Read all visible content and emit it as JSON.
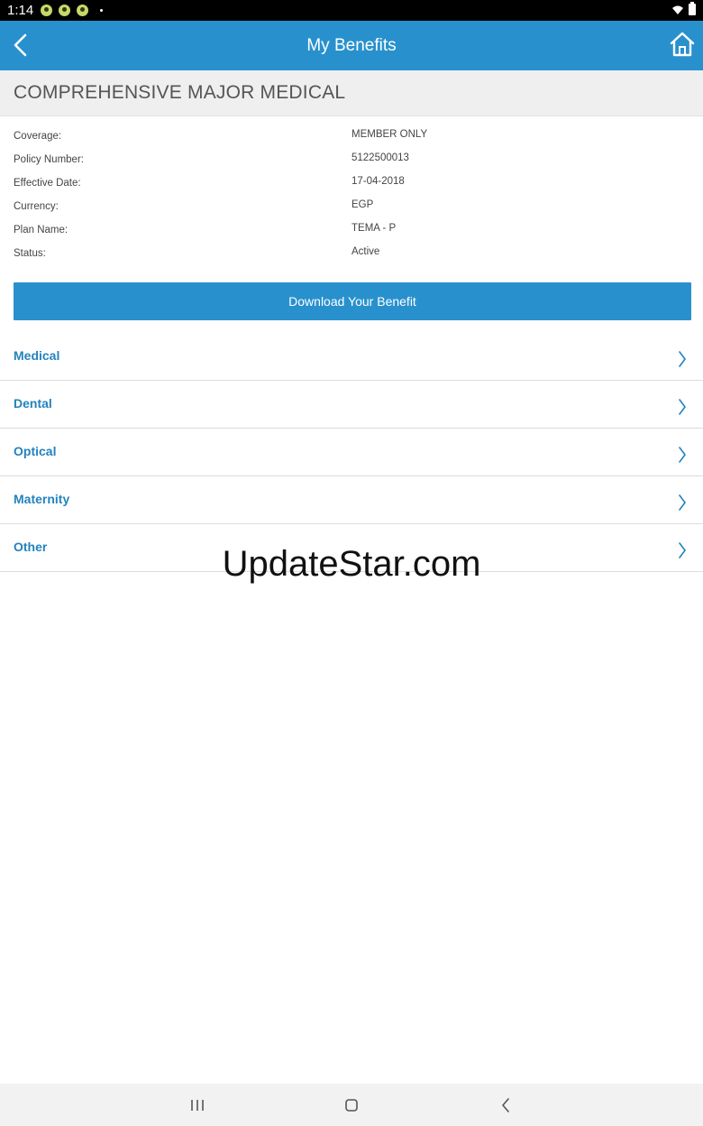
{
  "status_bar": {
    "time": "1:14",
    "app_icons": [
      "lime-notification-icon",
      "lime-notification-icon",
      "lime-notification-icon"
    ],
    "icons": [
      "wifi-icon",
      "battery-icon"
    ]
  },
  "app_bar": {
    "title": "My Benefits",
    "color": "#2891cd",
    "back_icon": "back-arrow-icon",
    "home_icon": "home-icon"
  },
  "plan": {
    "title": "COMPREHENSIVE MAJOR MEDICAL"
  },
  "details": [
    {
      "label": "Coverage:",
      "value": "MEMBER ONLY"
    },
    {
      "label": "Policy Number:",
      "value": "5122500013"
    },
    {
      "label": "Effective Date:",
      "value": "17-04-2018"
    },
    {
      "label": "Currency:",
      "value": "EGP"
    },
    {
      "label": "Plan Name:",
      "value": "TEMA - P"
    },
    {
      "label": "Status:",
      "value": "Active"
    }
  ],
  "download_button": {
    "label": "Download Your Benefit"
  },
  "benefit_categories": [
    {
      "label": "Medical"
    },
    {
      "label": "Dental"
    },
    {
      "label": "Optical"
    },
    {
      "label": "Maternity"
    },
    {
      "label": "Other"
    }
  ],
  "watermark": "UpdateStar.com",
  "nav_bar": {
    "icons": [
      "recents-icon",
      "home-icon",
      "back-icon"
    ]
  },
  "colors": {
    "accent": "#2891cd",
    "link": "#2283bd",
    "header_bg": "#efefef"
  }
}
